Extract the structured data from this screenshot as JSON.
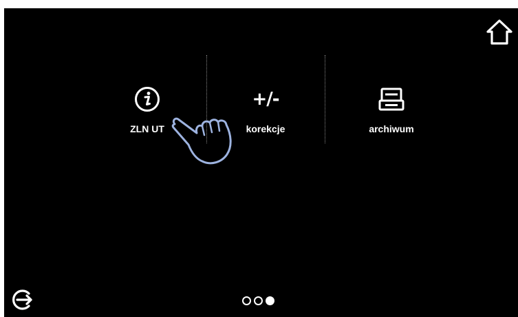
{
  "header": {
    "home_icon": "home-icon"
  },
  "menu": {
    "items": [
      {
        "label": "ZLN UT",
        "icon": "info-icon"
      },
      {
        "label": "korekcje",
        "icon": "plus-minus-icon",
        "glyph": "+/-"
      },
      {
        "label": "archiwum",
        "icon": "archive-icon"
      }
    ]
  },
  "footer": {
    "exit_icon": "exit-icon",
    "pager": {
      "total": 3,
      "active_index": 2
    }
  },
  "overlay": {
    "pointer_icon": "hand-pointer-icon"
  },
  "colors": {
    "screen_background": "#000000",
    "foreground": "#ffffff",
    "divider": "#8a8a8a",
    "hand_outline": "#9db3e0"
  }
}
